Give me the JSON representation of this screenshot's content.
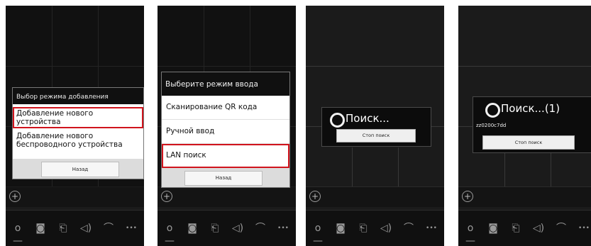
{
  "screen1": {
    "dialog_title": "Выбор режима добавления",
    "option_add_device": "Добавление нового устройства",
    "option_add_wireless": "Добавление нового беспроводного устройства",
    "back_button": "Назад"
  },
  "screen2": {
    "dialog_title": "Выберите режим ввода",
    "option_qr": "Сканирование QR кода",
    "option_manual": "Ручной ввод",
    "option_lan": "LAN поиск",
    "back_button": "Назад"
  },
  "screen3": {
    "search_label": "Поиск...",
    "stop_button": "Стоп поиск"
  },
  "screen4": {
    "search_label": "Поиск...(1)",
    "device_id": "zz0200c7dd",
    "stop_button": "Стоп поиск"
  },
  "toolbar": {
    "icons": [
      "key-icon",
      "camera-icon",
      "video-icon",
      "speaker-icon",
      "hangup-icon",
      "more-icon"
    ],
    "glyphs": [
      "o—",
      "◙",
      "⎗",
      "◁)",
      "⌒",
      "•••"
    ]
  },
  "colors": {
    "highlight": "#d0141d",
    "background": "#1b1b1b"
  }
}
